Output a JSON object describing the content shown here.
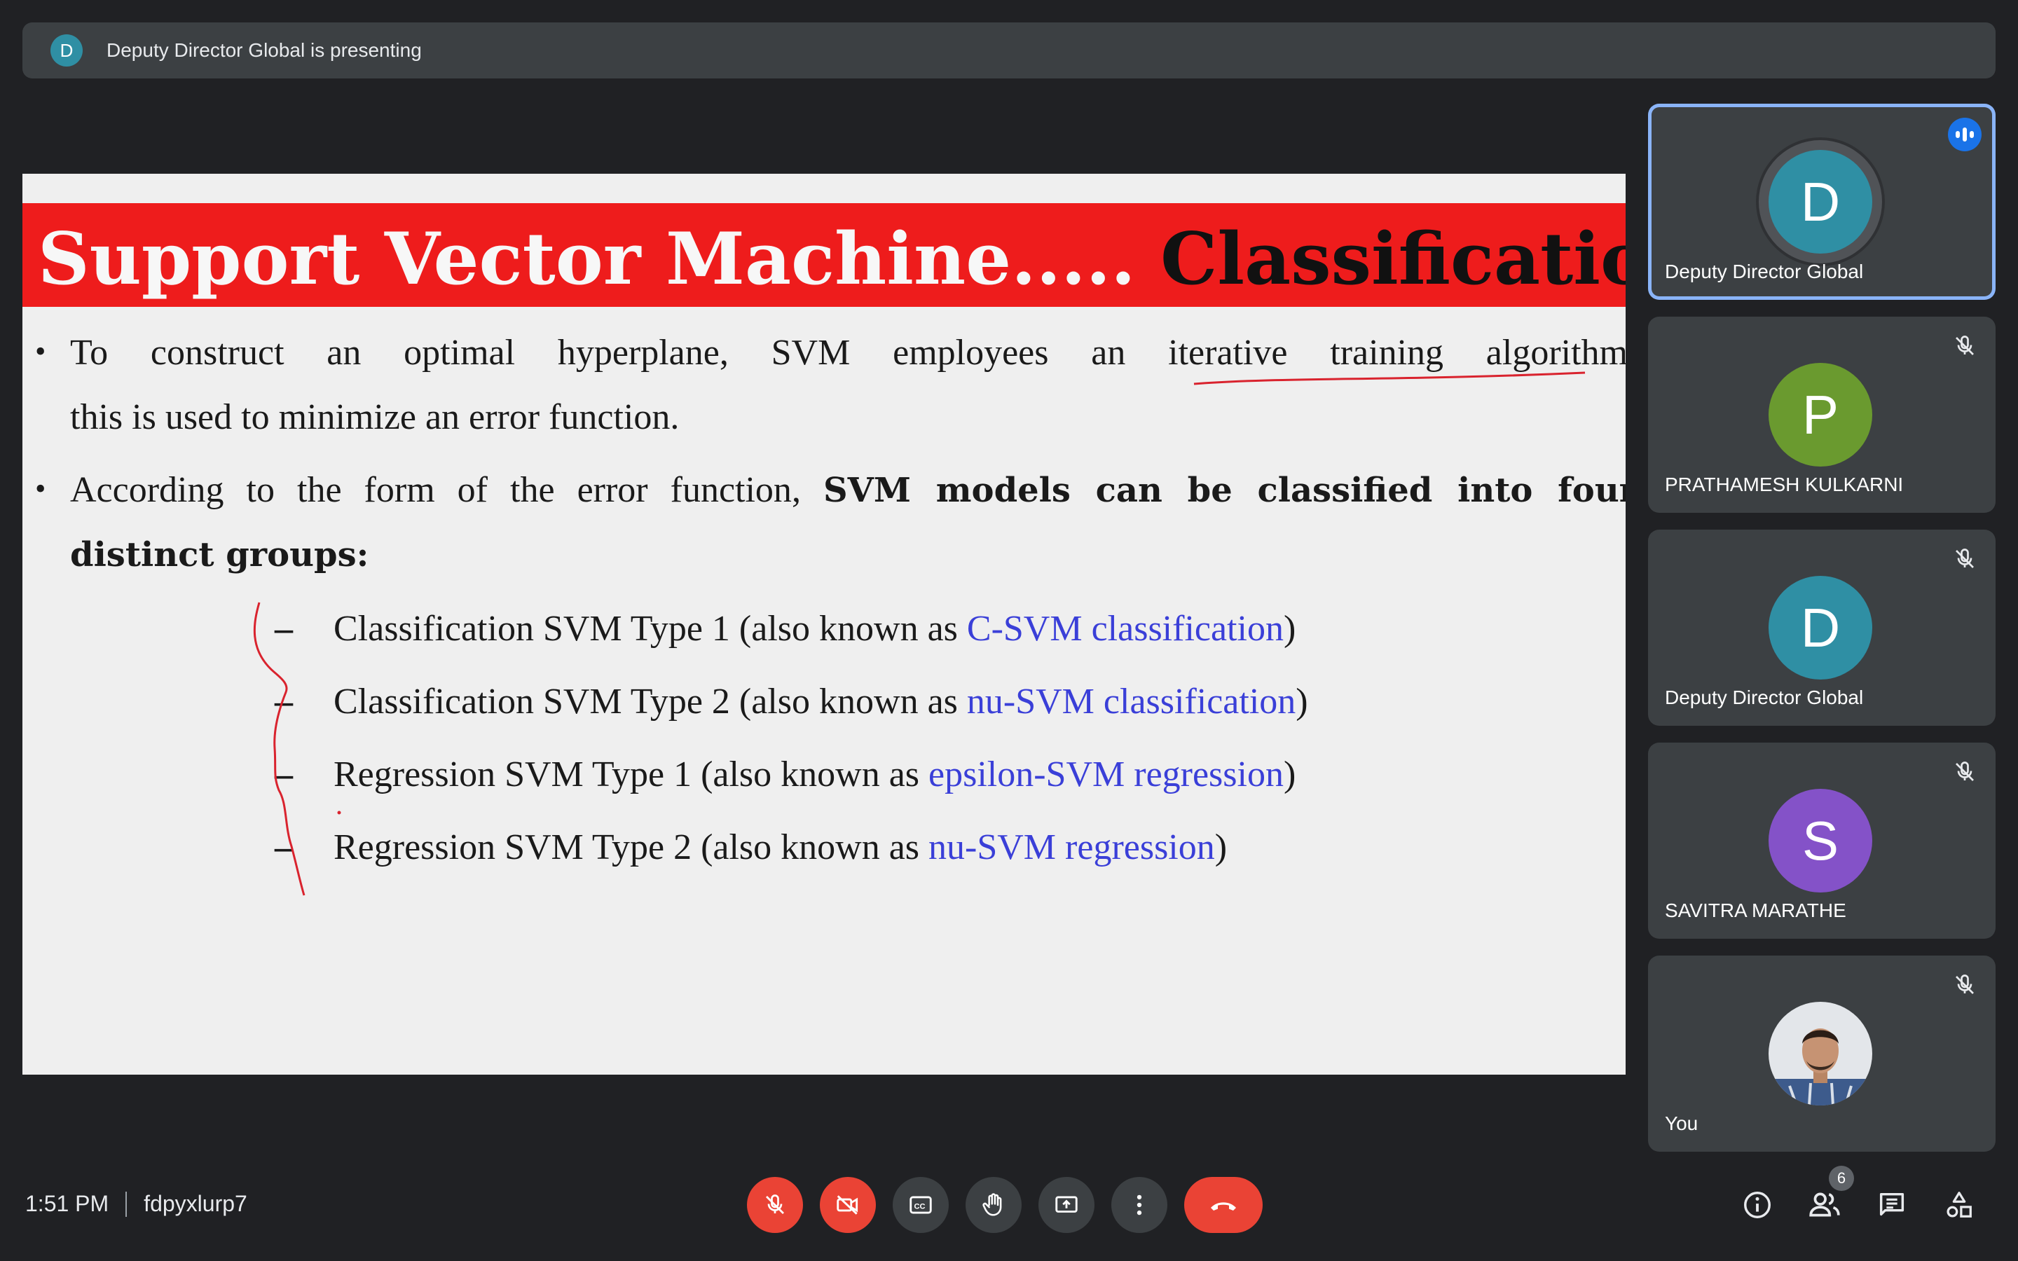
{
  "presenting_bar": {
    "avatar_letter": "D",
    "text": "Deputy Director Global is presenting"
  },
  "slide": {
    "title_part1": "Support Vector Machine.....",
    "title_part2": "Classification",
    "bullets": [
      {
        "line1_pre": "To construct an optimal hyperplane, SVM employees an",
        "line1_underlined": "iterative training algorithm",
        "line1_post": ",",
        "line2": "this is used to minimize an error function."
      },
      {
        "line1_pre": "According to the form of the error function,",
        "line1_bold": "SVM models can be classified into four",
        "line2_bold": "distinct groups:"
      }
    ],
    "sub_items": [
      {
        "dash": "–",
        "text": "Classification SVM Type 1 (also known as ",
        "link": "C-SVM classification",
        "close": ")"
      },
      {
        "dash": "–",
        "text": "Classification SVM Type 2 (also known as ",
        "link": "nu-SVM classification",
        "close": ")"
      },
      {
        "dash": "–",
        "text": "Regression SVM Type 1 (also known as ",
        "link": "epsilon-SVM regression",
        "close": ")"
      },
      {
        "dash": "–",
        "text": "Regression SVM Type 2 (also known as ",
        "link": "nu-SVM regression",
        "close": ")"
      }
    ],
    "colors": {
      "title_band": "#ee1c1c",
      "link": "#3a3fd8",
      "annotation": "#d9232e"
    }
  },
  "participants": [
    {
      "letter": "D",
      "name": "Deputy Director Global",
      "color": "#2f8fa4",
      "state": "speaking",
      "active": true
    },
    {
      "letter": "P",
      "name": "PRATHAMESH KULKARNI",
      "color": "#6a9a2f",
      "state": "muted",
      "active": false
    },
    {
      "letter": "D",
      "name": "Deputy Director Global",
      "color": "#2f8fa4",
      "state": "muted",
      "active": false
    },
    {
      "letter": "S",
      "name": "SAVITRA MARATHE",
      "color": "#8452c8",
      "state": "muted",
      "active": false
    },
    {
      "letter": "",
      "name": "You",
      "color": "#cfd3d8",
      "state": "muted",
      "active": false
    }
  ],
  "bottom_bar": {
    "time": "1:51 PM",
    "meeting_code": "fdpyxlurp7",
    "participants_count": "6",
    "controls": [
      {
        "name": "mic-off-icon",
        "state": "off"
      },
      {
        "name": "camera-off-icon",
        "state": "off"
      },
      {
        "name": "captions-icon",
        "state": "normal"
      },
      {
        "name": "raise-hand-icon",
        "state": "normal"
      },
      {
        "name": "present-screen-icon",
        "state": "normal"
      },
      {
        "name": "more-options-icon",
        "state": "normal"
      },
      {
        "name": "leave-call-icon",
        "state": "danger"
      }
    ],
    "right_icons": [
      "info-icon",
      "people-icon",
      "chat-icon",
      "activities-icon"
    ]
  }
}
